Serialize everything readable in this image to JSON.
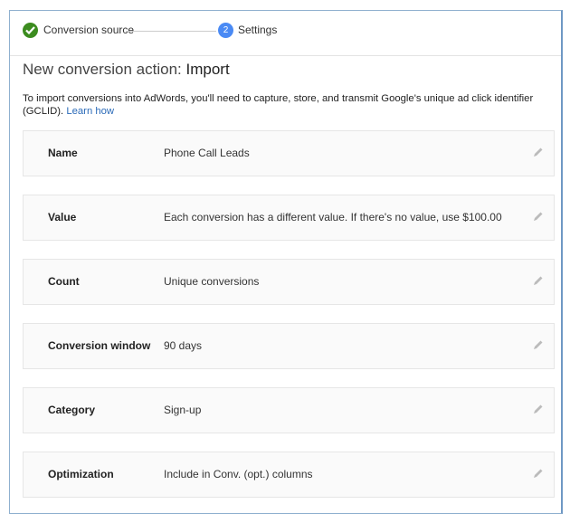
{
  "stepper": {
    "steps": [
      {
        "label": "Conversion source",
        "status": "complete",
        "icon": "check-circle-icon"
      },
      {
        "label": "Settings",
        "number": "2",
        "status": "current"
      }
    ]
  },
  "header": {
    "title_prefix": "New conversion action: ",
    "title_emphasis": "Import"
  },
  "description": {
    "text": "To import conversions into AdWords, you'll need to capture, store, and transmit Google's unique ad click identifier (GCLID). ",
    "link": "Learn how"
  },
  "settings": [
    {
      "label": "Name",
      "value": "Phone Call Leads"
    },
    {
      "label": "Value",
      "value": "Each conversion has a different value. If there's no value, use $100.00"
    },
    {
      "label": "Count",
      "value": "Unique conversions"
    },
    {
      "label": "Conversion window",
      "value": "90 days"
    },
    {
      "label": "Category",
      "value": "Sign-up"
    },
    {
      "label": "Optimization",
      "value": "Include in Conv. (opt.) columns"
    }
  ],
  "colors": {
    "check": "#3c8c1f",
    "step_current": "#4a8af4",
    "link": "#2a6ab8",
    "edit_icon": "#bbbbbb"
  }
}
